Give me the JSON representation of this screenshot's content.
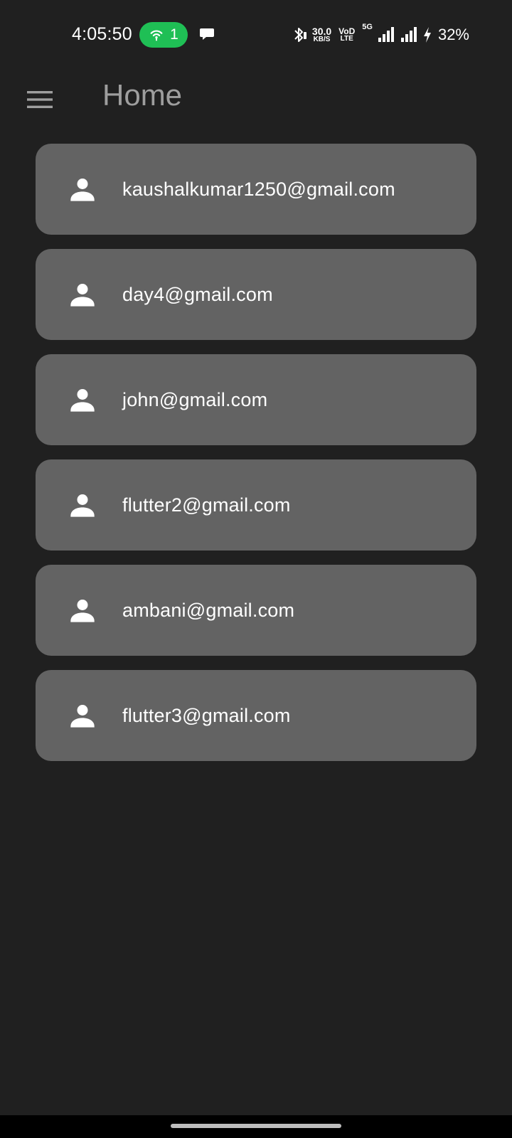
{
  "status_bar": {
    "time": "4:05:50",
    "hotspot_count": "1",
    "net_speed_value": "30.0",
    "net_speed_unit": "KB/S",
    "volte_top": "VoD",
    "volte_bottom": "LTE",
    "network_type": "5G",
    "battery_percent": "32%",
    "icons": [
      "hotspot-icon",
      "chat-bubble-icon",
      "bluetooth-icon",
      "signal-icon",
      "charging-bolt-icon"
    ],
    "hotspot_color": "#1fbf55"
  },
  "app_bar": {
    "title": "Home",
    "menu_icon": "hamburger-menu-icon"
  },
  "emails": [
    {
      "email": "kaushalkumar1250@gmail.com",
      "icon": "person-icon"
    },
    {
      "email": "day4@gmail.com",
      "icon": "person-icon"
    },
    {
      "email": "john@gmail.com",
      "icon": "person-icon"
    },
    {
      "email": "flutter2@gmail.com",
      "icon": "person-icon"
    },
    {
      "email": "ambani@gmail.com",
      "icon": "person-icon"
    },
    {
      "email": "flutter3@gmail.com",
      "icon": "person-icon"
    }
  ],
  "colors": {
    "background": "#202020",
    "card": "#636363",
    "title": "#9e9e9e",
    "text": "#ffffff"
  }
}
